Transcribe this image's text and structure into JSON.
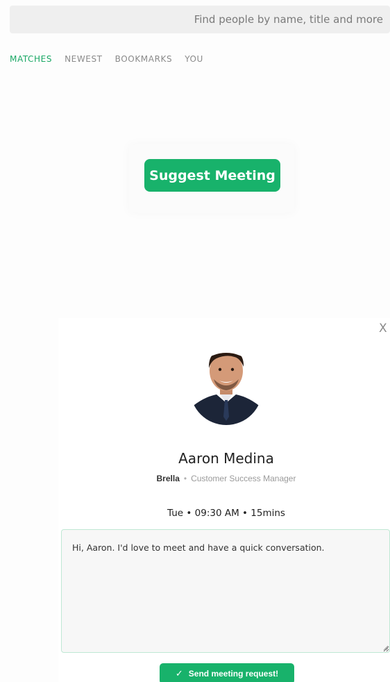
{
  "search": {
    "placeholder": "Find people by name, title and more"
  },
  "tabs": [
    {
      "label": "MATCHES",
      "active": true
    },
    {
      "label": "NEWEST",
      "active": false
    },
    {
      "label": "BOOKMARKS",
      "active": false
    },
    {
      "label": "YOU",
      "active": false
    }
  ],
  "suggest_button": {
    "label": "Suggest Meeting"
  },
  "modal": {
    "close_label": "X",
    "person": {
      "name": "Aaron Medina",
      "company": "Brella",
      "separator": "•",
      "title": "Customer Success Manager"
    },
    "meeting_time": "Tue • 09:30 AM • 15mins",
    "message": "Hi, Aaron. I'd love to meet and have a quick conversation.",
    "send_button": {
      "label": "Send meeting request!"
    }
  },
  "colors": {
    "accent": "#18b26b",
    "active_tab": "#1aa865",
    "message_border": "#bfe8d4"
  },
  "icons": {
    "close": "close-icon",
    "check": "check-icon",
    "resize": "resize-grip-icon"
  }
}
